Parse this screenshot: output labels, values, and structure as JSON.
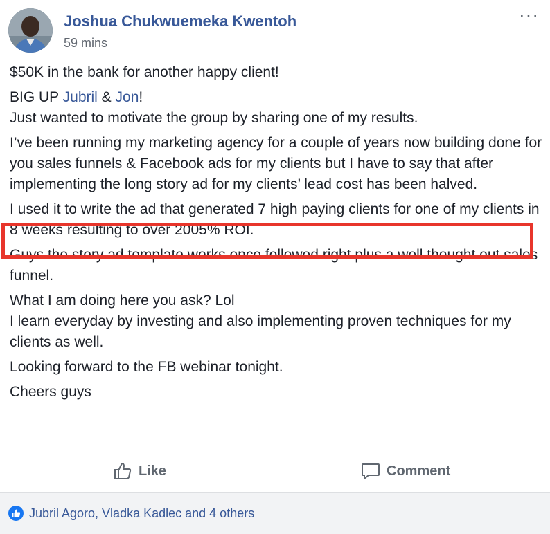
{
  "post": {
    "author": "Joshua Chukwuemeka Kwentoh",
    "timestamp": "59 mins",
    "more_label": "···",
    "paragraphs": {
      "p1": "$50K in the bank for another happy client!",
      "p2_prefix": "BIG UP ",
      "p2_mention1": "Jubril",
      "p2_amp": " & ",
      "p2_mention2": "Jon",
      "p2_suffix": "!",
      "p2_line2": "Just wanted to motivate the group by sharing one of my results.",
      "p3": "I’ve been running my marketing agency for a couple of years now building done for you sales funnels & Facebook ads for my clients but I have to say that after implementing the long story ad for my clients’ lead cost has been halved.",
      "p4": "I used it to write the ad that generated 7 high paying clients for one of my clients in 8 weeks resulting to over 2005% ROI.",
      "p5": "Guys the story ad template works once followed right plus a well thought out sales funnel.",
      "p6_line1": "What I am doing here you ask? Lol",
      "p6_line2": "I learn everyday by investing and also implementing proven techniques for my clients as well.",
      "p7": "Looking forward to the FB webinar tonight.",
      "p8": "Cheers guys"
    }
  },
  "actions": {
    "like_label": "Like",
    "comment_label": "Comment"
  },
  "footer": {
    "reactions_text": "Jubril Agoro, Vladka Kadlec and 4 others"
  },
  "icons": {
    "avatar": "avatar",
    "more": "more-options-icon",
    "like": "thumbs-up-icon",
    "comment": "comment-icon",
    "reaction": "like-reaction-icon"
  },
  "colors": {
    "link": "#385898",
    "highlight_border": "#e8352b",
    "like_badge": "#1877f2"
  }
}
